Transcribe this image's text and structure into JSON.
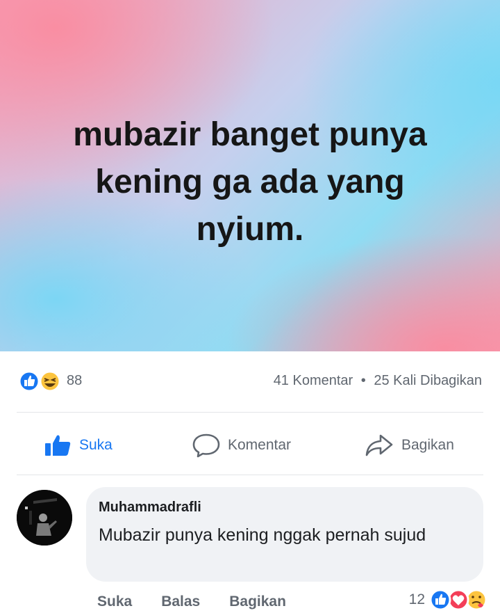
{
  "post": {
    "text_line1": "mubazir banget punya",
    "text_line2": "kening ga ada yang",
    "text_line3": "nyium."
  },
  "stats": {
    "reaction_count": "88",
    "reaction_icons": [
      "like-icon",
      "haha-icon"
    ],
    "comments": "41 Komentar",
    "separator": "•",
    "shares": "25 Kali Dibagikan"
  },
  "actions": {
    "like_label": "Suka",
    "comment_label": "Komentar",
    "share_label": "Bagikan"
  },
  "comment": {
    "author": "Muhammadrafli",
    "text": "Mubazir punya kening nggak pernah sujud",
    "like_label": "Suka",
    "reply_label": "Balas",
    "share_label": "Bagikan",
    "reaction_count": "12",
    "reaction_icons": [
      "like-icon",
      "love-icon",
      "care-icon"
    ]
  },
  "colors": {
    "facebook_blue": "#1877f2",
    "love_red": "#f33e58",
    "emoji_yellow": "#fcc43f",
    "muted_text": "#606770"
  }
}
